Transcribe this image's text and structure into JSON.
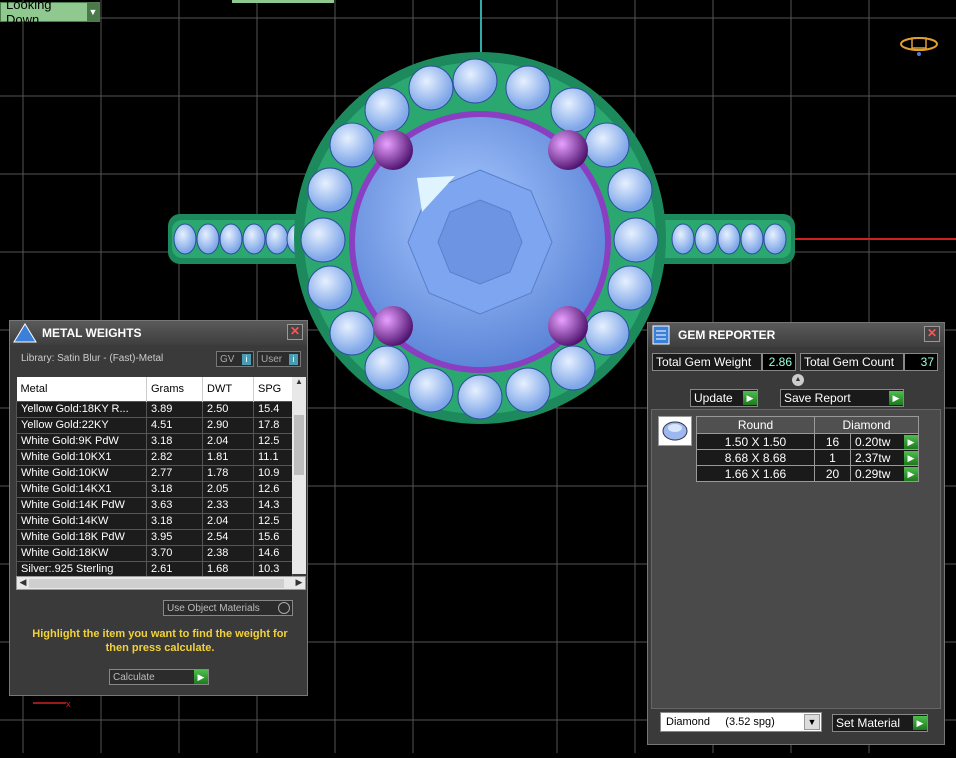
{
  "viewport": {
    "label": "Looking Down"
  },
  "metal_weights": {
    "title": "METAL WEIGHTS",
    "library": "Library: Satin Blur - (Fast)-Metal",
    "gv_label": "GV",
    "user_label": "User",
    "columns": [
      "Metal",
      "Grams",
      "DWT",
      "SPG"
    ],
    "rows": [
      [
        "Yellow Gold:18KY R...",
        "3.89",
        "2.50",
        "15.4"
      ],
      [
        "Yellow Gold:22KY",
        "4.51",
        "2.90",
        "17.8"
      ],
      [
        "White Gold:9K PdW",
        "3.18",
        "2.04",
        "12.5"
      ],
      [
        "White Gold:10KX1",
        "2.82",
        "1.81",
        "11.1"
      ],
      [
        "White Gold:10KW",
        "2.77",
        "1.78",
        "10.9"
      ],
      [
        "White Gold:14KX1",
        "3.18",
        "2.05",
        "12.6"
      ],
      [
        "White Gold:14K PdW",
        "3.63",
        "2.33",
        "14.3"
      ],
      [
        "White Gold:14KW",
        "3.18",
        "2.04",
        "12.5"
      ],
      [
        "White Gold:18K PdW",
        "3.95",
        "2.54",
        "15.6"
      ],
      [
        "White Gold:18KW",
        "3.70",
        "2.38",
        "14.6"
      ],
      [
        "Silver:.925 Sterling",
        "2.61",
        "1.68",
        "10.3"
      ]
    ],
    "use_object_materials": "Use Object Materials",
    "hint": "Highlight the item you want to find the weight for then press calculate.",
    "calculate": "Calculate"
  },
  "gem_reporter": {
    "title": "GEM REPORTER",
    "total_weight_label": "Total Gem Weight",
    "total_weight": "2.86",
    "total_count_label": "Total Gem Count",
    "total_count": "37",
    "update": "Update",
    "save_report": "Save Report",
    "columns": [
      "Round",
      "Diamond"
    ],
    "rows": [
      [
        "1.50 X 1.50",
        "16",
        "0.20tw"
      ],
      [
        "8.68 X 8.68",
        "1",
        "2.37tw"
      ],
      [
        "1.66 X 1.66",
        "20",
        "0.29tw"
      ]
    ],
    "material_select": "Diamond     (3.52 spg)",
    "set_material": "Set Material"
  }
}
